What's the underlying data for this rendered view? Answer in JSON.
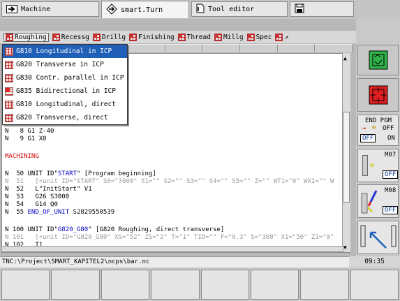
{
  "tabs": [
    {
      "label": "Machine",
      "icon": "arrow-right-box-icon"
    },
    {
      "label": "smart.Turn",
      "icon": "diamond-arrows-icon"
    },
    {
      "label": "Tool editor",
      "icon": "document-icon"
    },
    {
      "label": "",
      "icon": "save-disk-icon"
    }
  ],
  "menu": {
    "items": [
      "Roughing",
      "Recessg",
      "Drillg",
      "Finishing",
      "Thread",
      "Millg",
      "Spec"
    ],
    "more": "↗"
  },
  "dropdown": [
    "G810 Longitudinal in ICP",
    "G820 Transverse in ICP",
    "G830 Contr. parallel in ICP",
    "G835 Bidirectional in ICP",
    "G810 Longitudinal, direct",
    "G820 Transverse, direct"
  ],
  "editor": {
    "lines": [
      {
        "n": "N   8 G1 Z-40",
        "cls": "k-dark"
      },
      {
        "n": "N   9 G1 X0",
        "cls": "k-dark"
      },
      {
        "n": "MACHINING",
        "cls": "k-red"
      },
      {
        "n": "N  50 UNIT ID\"START\" [Program beginning]",
        "cls": "k-dark"
      },
      {
        "n": "N  51   [<unit ID=\"START\" S0=\"3000\" S1=\"\" S2=\"\" S3=\"\" S4=\"\" S5=\"\" Z=\"\" WT1=\"0\" WX1=\"\" W",
        "cls": "k-grey"
      },
      {
        "n": "N  52   L\"InitStart\" V1",
        "cls": "k-dark"
      },
      {
        "n": "N  53   G26 S3000",
        "cls": "k-dark"
      },
      {
        "n": "N  54   G14 Q0",
        "cls": "k-dark"
      },
      {
        "n": "N  55 END_OF_UNIT S2829550539",
        "cls": "k-dark"
      },
      {
        "n": "N 100 UNIT ID\"G820_G80\" [G820 Roughing, direct transverse]",
        "cls": "k-dark"
      },
      {
        "n": "N 101   [<unit ID=\"G820_G80\" XS=\"52\" ZS=\"2\" T=\"1\" TID=\"\" F=\"0.3\" S=\"300\" X1=\"50\" Z1=\"0\"",
        "cls": "k-grey"
      },
      {
        "n": "N 102   T1",
        "cls": "k-dark"
      }
    ]
  },
  "right": {
    "endpgm": "END PGM",
    "off": "OFF",
    "on": "ON",
    "m07": "M07",
    "m08": "M08",
    "off_badge": "OFF"
  },
  "status": {
    "path": "TNC:\\Project\\SMART_KAPITEL2\\ncps\\bar.nc",
    "time": "09:35"
  }
}
